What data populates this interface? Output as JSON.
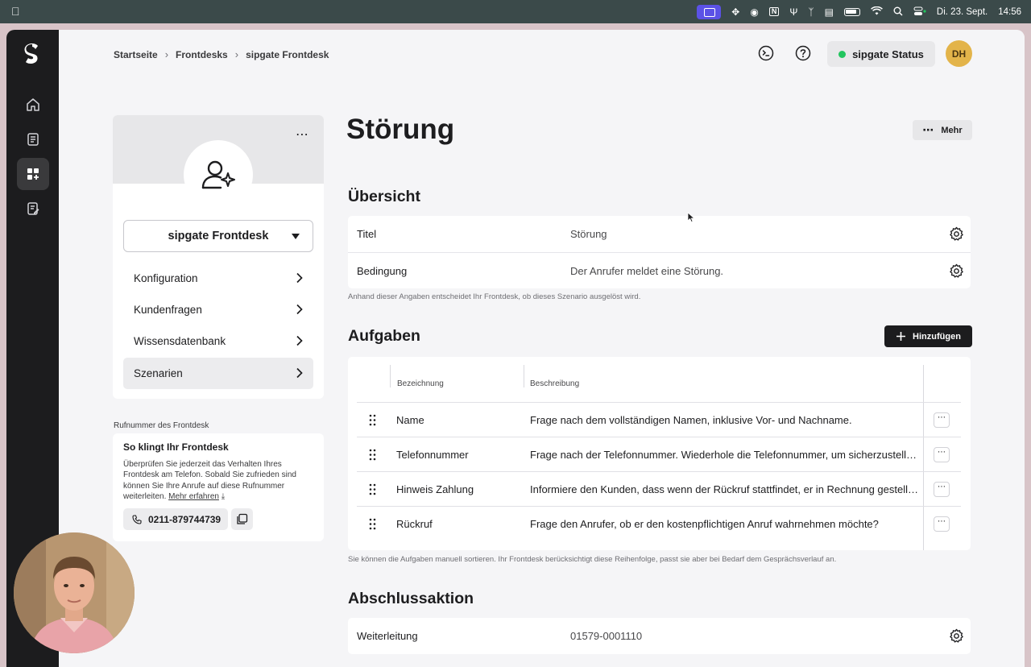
{
  "menubar": {
    "date": "Di. 23. Sept.",
    "time": "14:56"
  },
  "breadcrumb": {
    "home": "Startseite",
    "section": "Frontdesks",
    "current": "sipgate Frontdesk"
  },
  "header": {
    "status_label": "sipgate Status",
    "avatar_initials": "DH"
  },
  "sidebar": {
    "frontdesk_name": "sipgate Frontdesk",
    "items": [
      {
        "label": "Konfiguration"
      },
      {
        "label": "Kundenfragen"
      },
      {
        "label": "Wissensdatenbank"
      },
      {
        "label": "Szenarien"
      }
    ],
    "phone_section_label": "Rufnummer des Frontdesk",
    "phone_card": {
      "title": "So klingt Ihr Frontdesk",
      "body": "Überprüfen Sie jederzeit das Verhalten Ihres Frontdesk am Telefon. Sobald Sie zufrieden sind können Sie Ihre Anrufe auf diese Rufnummer weiterleiten.",
      "link": "Mehr erfahren",
      "number": "0211-879744739"
    }
  },
  "main": {
    "title": "Störung",
    "more_label": "Mehr",
    "overview": {
      "heading": "Übersicht",
      "rows": [
        {
          "label": "Titel",
          "value": "Störung"
        },
        {
          "label": "Bedingung",
          "value": "Der Anrufer meldet eine Störung."
        }
      ],
      "hint": "Anhand dieser Angaben entscheidet Ihr Frontdesk, ob dieses Szenario ausgelöst wird."
    },
    "tasks": {
      "heading": "Aufgaben",
      "add_label": "Hinzufügen",
      "columns": [
        "Bezeichnung",
        "Beschreibung"
      ],
      "rows": [
        {
          "name": "Name",
          "description": "Frage nach dem vollständigen Namen, inklusive Vor- und Nachname."
        },
        {
          "name": "Telefonnummer",
          "description": "Frage nach der Telefonnummer. Wiederhole die Telefonnummer, um sicherzustellen, dass sie korrekt ist."
        },
        {
          "name": "Hinweis Zahlung",
          "description": "Informiere den Kunden, dass wenn der Rückruf stattfindet, er in Rechnung gestellt wird."
        },
        {
          "name": "Rückruf",
          "description": "Frage den Anrufer, ob er den kostenpflichtigen Anruf wahrnehmen möchte?"
        }
      ],
      "hint": "Sie können die Aufgaben manuell sortieren. Ihr Frontdesk berücksichtigt diese Reihenfolge, passt sie aber bei Bedarf dem Gesprächsverlauf an."
    },
    "final_action": {
      "heading": "Abschlussaktion",
      "label": "Weiterleitung",
      "value": "01579-0001110"
    }
  },
  "colors": {
    "rail": "#1c1c1e",
    "accent_status": "#22c55e",
    "avatar": "#e3b44a",
    "primary_button": "#1c1c1e"
  }
}
